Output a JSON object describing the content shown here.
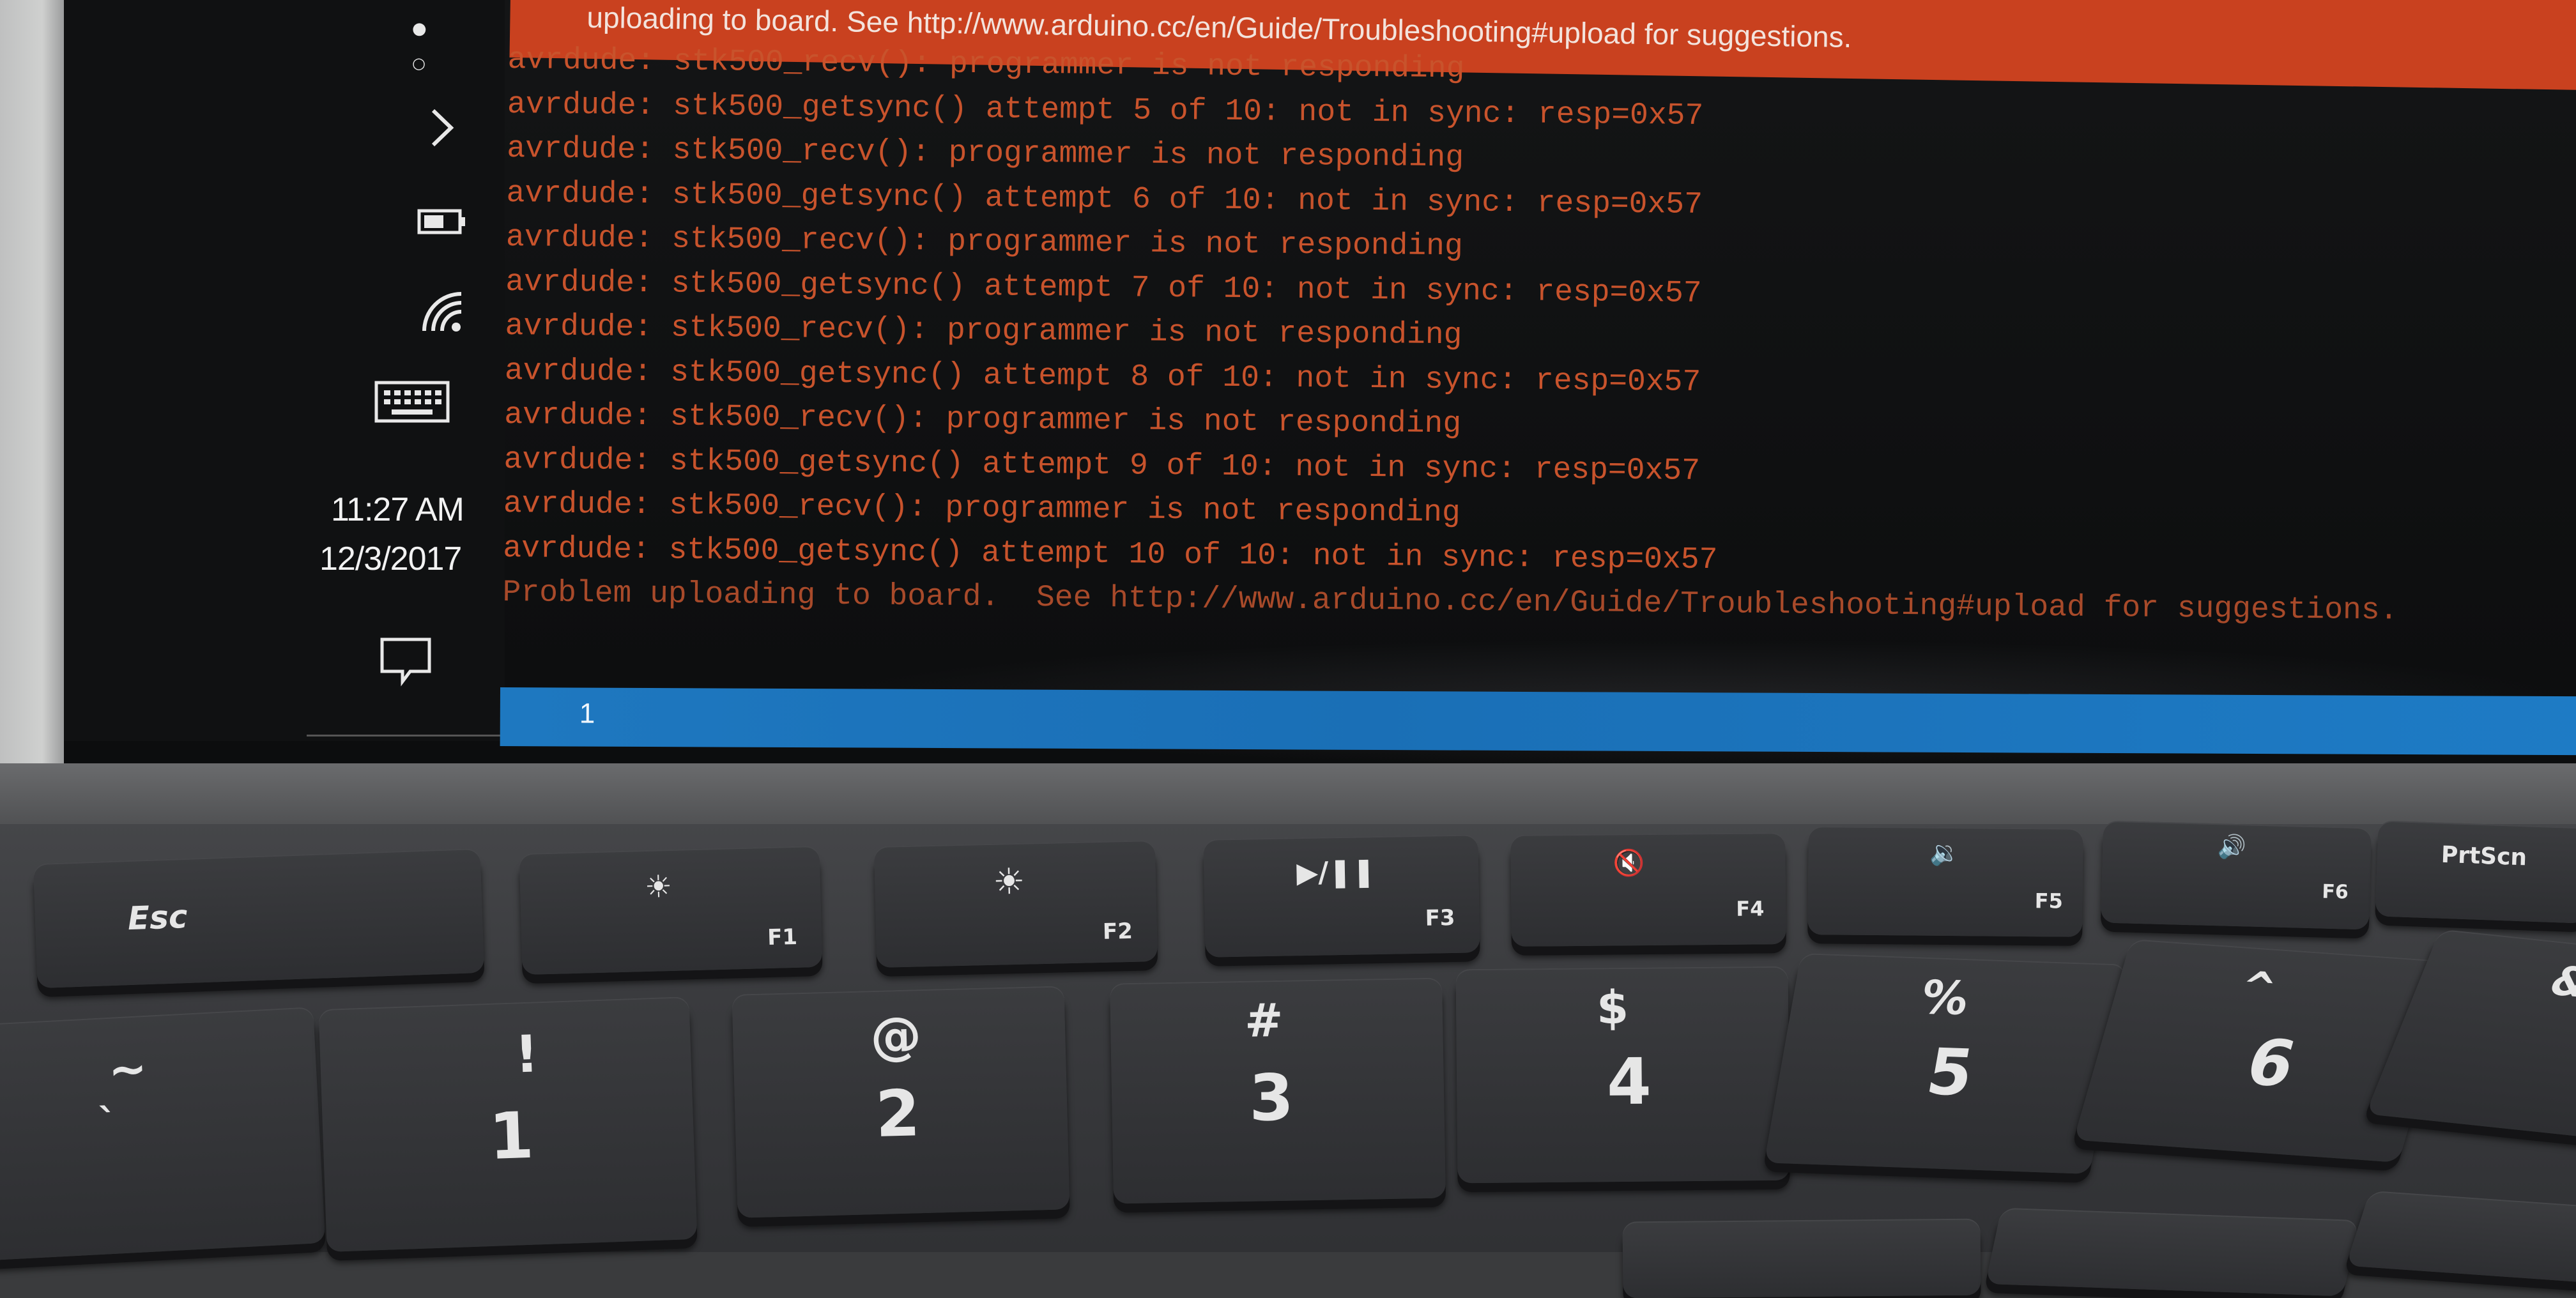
{
  "error_banner": {
    "text": "uploading to board.  See http://www.arduino.cc/en/Guide/Troubleshooting#upload for suggestions."
  },
  "console_lines": [
    "avrdude: stk500_recv(): programmer is not responding",
    "avrdude: stk500_getsync() attempt 5 of 10: not in sync: resp=0x57",
    "avrdude: stk500_recv(): programmer is not responding",
    "avrdude: stk500_getsync() attempt 6 of 10: not in sync: resp=0x57",
    "avrdude: stk500_recv(): programmer is not responding",
    "avrdude: stk500_getsync() attempt 7 of 10: not in sync: resp=0x57",
    "avrdude: stk500_recv(): programmer is not responding",
    "avrdude: stk500_getsync() attempt 8 of 10: not in sync: resp=0x57",
    "avrdude: stk500_recv(): programmer is not responding",
    "avrdude: stk500_getsync() attempt 9 of 10: not in sync: resp=0x57",
    "avrdude: stk500_recv(): programmer is not responding",
    "avrdude: stk500_getsync() attempt 10 of 10: not in sync: resp=0x57",
    "Problem uploading to board.  See http://www.arduino.cc/en/Guide/Troubleshooting#upload for suggestions."
  ],
  "status_bar": {
    "line_number": "1"
  },
  "taskbar": {
    "time": "11:27 AM",
    "date": "12/3/2017",
    "icons": [
      "chevron-right-icon",
      "battery-icon",
      "wifi-icon",
      "keyboard-icon",
      "notification-icon"
    ]
  },
  "keyboard": {
    "function_row": [
      {
        "main": "Esc",
        "sub": ""
      },
      {
        "main": "☀",
        "sub": "F1"
      },
      {
        "main": "☀",
        "sub": "F2"
      },
      {
        "main": "▶/❚❚",
        "sub": "F3"
      },
      {
        "main": "🔇",
        "sub": "F4"
      },
      {
        "main": "🔉",
        "sub": "F5"
      },
      {
        "main": "🔊",
        "sub": "F6"
      },
      {
        "main": "PrtScn",
        "sub": ""
      }
    ],
    "number_row": [
      {
        "top": "~",
        "bottom": "`"
      },
      {
        "top": "!",
        "bottom": "1"
      },
      {
        "top": "@",
        "bottom": "2"
      },
      {
        "top": "#",
        "bottom": "3"
      },
      {
        "top": "$",
        "bottom": "4"
      },
      {
        "top": "%",
        "bottom": "5"
      },
      {
        "top": "^",
        "bottom": "6"
      },
      {
        "top": "&",
        "bottom": ""
      }
    ]
  },
  "colors": {
    "console_text": "#c8532c",
    "error_banner": "#c9411f",
    "status_bar": "#1e78c0"
  }
}
